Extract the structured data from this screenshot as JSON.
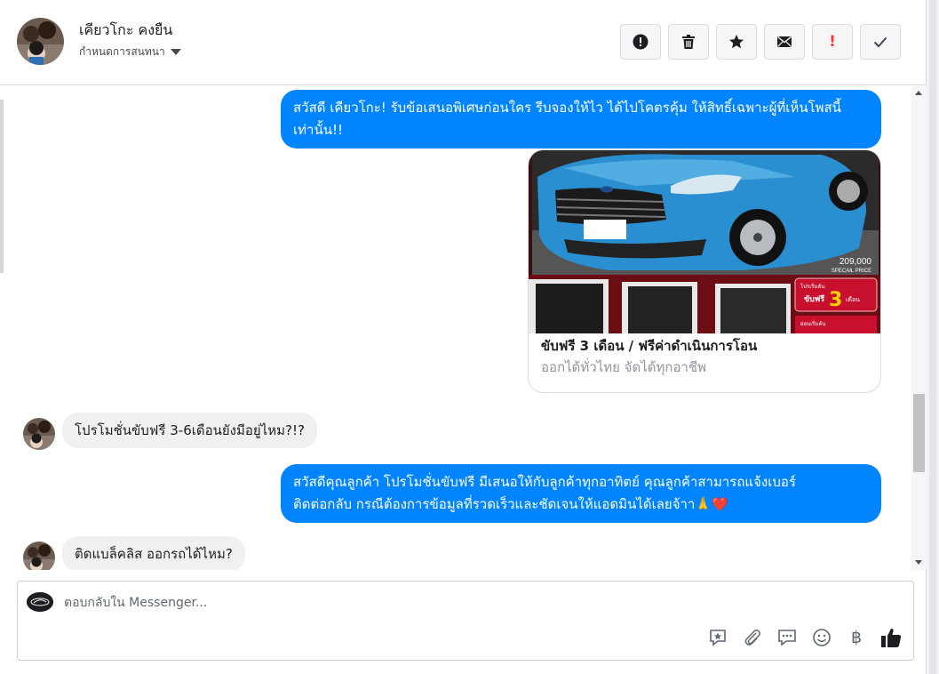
{
  "header": {
    "contact_name": "เคียวโกะ คงยืน",
    "assign_label": "กำหนดการสนทนา",
    "actions": [
      {
        "name": "mark-spam-button",
        "icon": "alert-circle-icon"
      },
      {
        "name": "delete-button",
        "icon": "trash-icon"
      },
      {
        "name": "star-button",
        "icon": "star-icon"
      },
      {
        "name": "mark-unread-button",
        "icon": "envelope-icon"
      },
      {
        "name": "follow-up-button",
        "icon": "exclamation-icon",
        "label": "!"
      },
      {
        "name": "mark-done-button",
        "icon": "checkmark-icon"
      }
    ]
  },
  "messages": {
    "m1": {
      "from": "page",
      "text": "สวัสดี เคียวโกะ! รับข้อเสนอพิเศษก่อนใคร รีบจองให้ไว ได้ไปโคตรคุ้ม ให้สิทธิ์เฉพาะผู้ที่เห็นโพสนี้เท่านั้น!!"
    },
    "card": {
      "title": "ขับฟรี 3 เดือน / ฟรีค่าดำเนินการโอน",
      "subtitle": "ออกได้ทั่วไทย จัดได้ทุกอาชีพ",
      "image": {
        "price": "209,000",
        "price_caption": "SPECAIL PRICE",
        "promo_label": "ขับฟรี",
        "promo_number": "3",
        "promo_unit": "เดือน",
        "promo_top": "โปรเริ่มต้น",
        "promo_bottom": "ผ่อนเริ่มต้น",
        "colors": {
          "car": "#2a8fd0",
          "banner": "#c8102e"
        }
      }
    },
    "m2": {
      "from": "customer",
      "text": "โปรโมชั่นขับฟรี 3-6เดือนยังมีอยู่ไหม?!?"
    },
    "m3": {
      "from": "page",
      "text_line1": "สวัสดีคุณลูกค้า โปรโมชั่นขับฟรี มีเสนอให้กับลูกค้าทุกอาทิตย์ คุณลูกค้าสามารถแจ้งเบอร์",
      "text_line2": "ติดต่อกลับ กรณีต้องการข้อมูลที่รวดเร็วและชัดเจนให้แอดมินได้เลยจ้าา🙏❤️"
    },
    "m4": {
      "from": "customer",
      "text": "ติดแบล็คลิส ออกรถได้ไหม?"
    }
  },
  "composer": {
    "placeholder": "ตอบกลับใน Messenger...",
    "tools": [
      "saved-reply-icon",
      "attachment-icon",
      "chat-icon",
      "emoji-icon",
      "baht-icon",
      "like-icon"
    ],
    "baht_symbol": "฿"
  },
  "colors": {
    "accent": "#0084ff",
    "incoming_bubble": "#f1f0f0",
    "follow_up": "#fa383e"
  }
}
